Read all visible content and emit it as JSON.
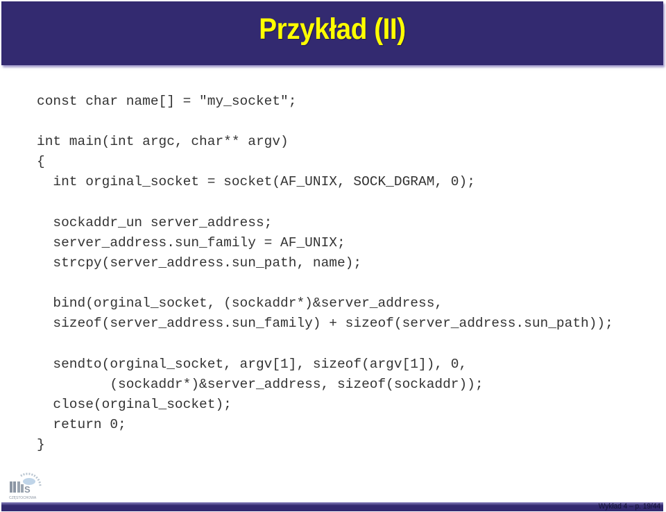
{
  "slide": {
    "title": "Przykład (II)",
    "footer": "Wykład 4 – p. 19/44",
    "colors": {
      "header_bg": "#332a70",
      "title": "#ffff00",
      "code_text": "#333333"
    }
  },
  "code": {
    "language": "c",
    "lines": [
      "const char name[] = \"my_socket\";",
      "",
      "int main(int argc, char** argv)",
      "{",
      "  int orginal_socket = socket(AF_UNIX, SOCK_DGRAM, 0);",
      "",
      "  sockaddr_un server_address;",
      "  server_address.sun_family = AF_UNIX;",
      "  strcpy(server_address.sun_path, name);",
      "",
      "  bind(orginal_socket, (sockaddr*)&server_address,",
      "  sizeof(server_address.sun_family) + sizeof(server_address.sun_path));",
      "",
      "  sendto(orginal_socket, argv[1], sizeof(argv[1]), 0,",
      "         (sockaddr*)&server_address, sizeof(sockaddr));",
      "  close(orginal_socket);",
      "  return 0;",
      "}"
    ]
  },
  "logo": {
    "icon": "university-logo-icon",
    "caption": "CZĘSTOCHOWA"
  }
}
